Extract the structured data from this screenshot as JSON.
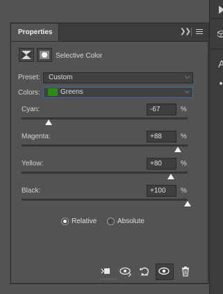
{
  "panel": {
    "tab_title": "Properties",
    "adjustment_title": "Selective Color",
    "preset": {
      "label": "Preset:",
      "value": "Custom"
    },
    "colors": {
      "label": "Colors:",
      "value": "Greens",
      "swatch_color": "#2a8a12"
    },
    "sliders": [
      {
        "label": "Cyan:",
        "value": "-67",
        "unit": "%",
        "level": -67
      },
      {
        "label": "Magenta:",
        "value": "+88",
        "unit": "%",
        "level": 88
      },
      {
        "label": "Yellow:",
        "value": "+80",
        "unit": "%",
        "level": 80
      },
      {
        "label": "Black:",
        "value": "+100",
        "unit": "%",
        "level": 100
      }
    ],
    "method": {
      "options": [
        "Relative",
        "Absolute"
      ],
      "selected": "Relative"
    },
    "bottom_icons": [
      "clip-to-layer-icon",
      "view-previous-state-icon",
      "reset-icon",
      "toggle-visibility-icon",
      "delete-icon"
    ]
  }
}
